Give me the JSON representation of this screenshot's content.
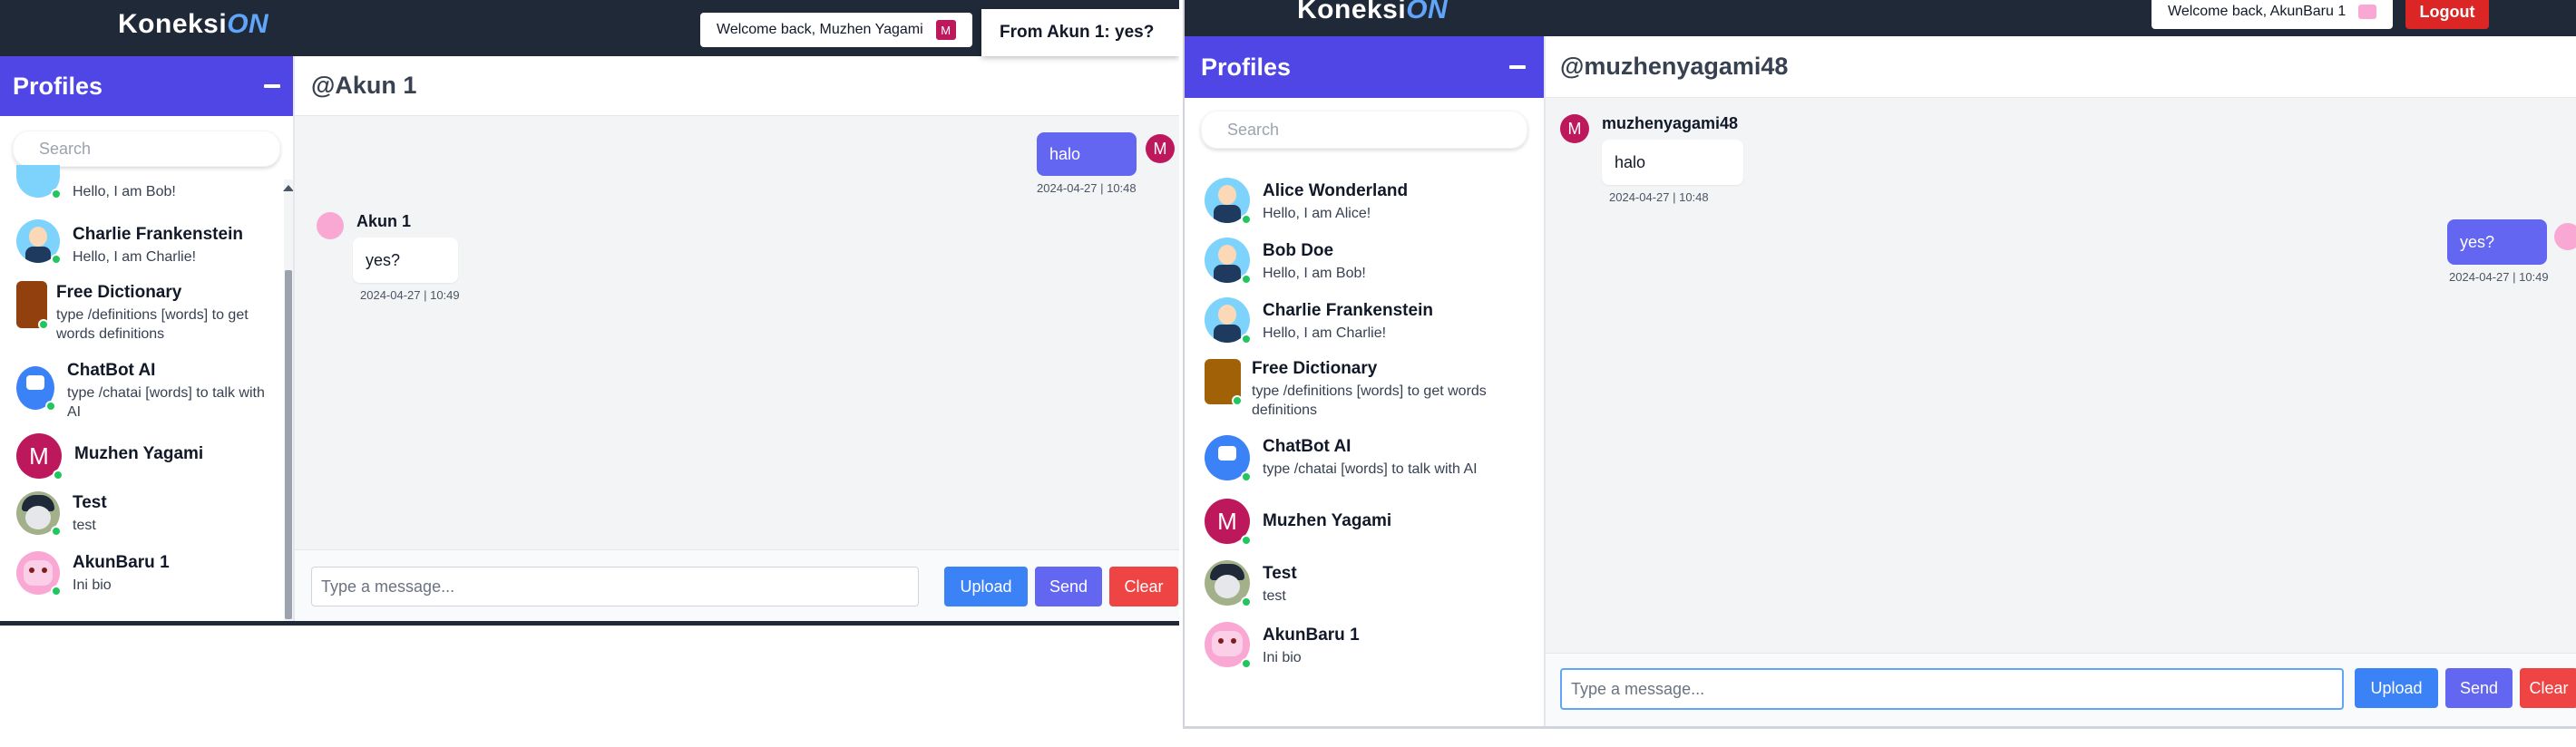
{
  "left": {
    "logo_main": "Koneksi",
    "logo_accent": "ON",
    "welcome_text": "Welcome back, Muzhen Yagami",
    "welcome_avatar_letter": "M",
    "notification": "From Akun 1: yes?",
    "sidebar_title": "Profiles",
    "search_placeholder": "Search",
    "profiles": [
      {
        "name": "",
        "bio": "Hello, I am Bob!"
      },
      {
        "name": "Charlie Frankenstein",
        "bio": "Hello, I am Charlie!"
      },
      {
        "name": "Free Dictionary",
        "bio": "type /definitions [words] to get words definitions"
      },
      {
        "name": "ChatBot AI",
        "bio": "type /chatai [words] to talk with AI"
      },
      {
        "name": "Muzhen Yagami",
        "bio": "",
        "letter": "M"
      },
      {
        "name": "Test",
        "bio": "test"
      },
      {
        "name": "AkunBaru 1",
        "bio": "Ini bio"
      }
    ],
    "chat_title": "@Akun 1",
    "messages": [
      {
        "direction": "out",
        "text": "halo",
        "time": "2024-04-27 | 10:48",
        "avatar_letter": "M"
      },
      {
        "direction": "in",
        "sender": "Akun 1",
        "text": "yes?",
        "time": "2024-04-27 | 10:49"
      }
    ],
    "input_placeholder": "Type a message...",
    "upload_label": "Upload",
    "send_label": "Send",
    "clear_label": "Clear"
  },
  "right": {
    "logo_main": "Koneksi",
    "logo_accent": "ON",
    "welcome_text": "Welcome back, AkunBaru 1",
    "logout_label": "Logout",
    "sidebar_title": "Profiles",
    "search_placeholder": "Search",
    "profiles": [
      {
        "name": "Alice Wonderland",
        "bio": "Hello, I am Alice!"
      },
      {
        "name": "Bob Doe",
        "bio": "Hello, I am Bob!"
      },
      {
        "name": "Charlie Frankenstein",
        "bio": "Hello, I am Charlie!"
      },
      {
        "name": "Free Dictionary",
        "bio": "type /definitions [words] to get words definitions"
      },
      {
        "name": "ChatBot AI",
        "bio": "type /chatai [words] to talk with AI"
      },
      {
        "name": "Muzhen Yagami",
        "bio": "",
        "letter": "M"
      },
      {
        "name": "Test",
        "bio": "test"
      },
      {
        "name": "AkunBaru 1",
        "bio": "Ini bio"
      }
    ],
    "chat_title": "@muzhenyagami48",
    "messages": [
      {
        "direction": "in",
        "sender": "muzhenyagami48",
        "text": "halo",
        "time": "2024-04-27 | 10:48",
        "avatar_letter": "M"
      },
      {
        "direction": "out",
        "text": "yes?",
        "time": "2024-04-27 | 10:49"
      }
    ],
    "input_placeholder": "Type a message...",
    "upload_label": "Upload",
    "send_label": "Send",
    "clear_label": "Clear"
  }
}
